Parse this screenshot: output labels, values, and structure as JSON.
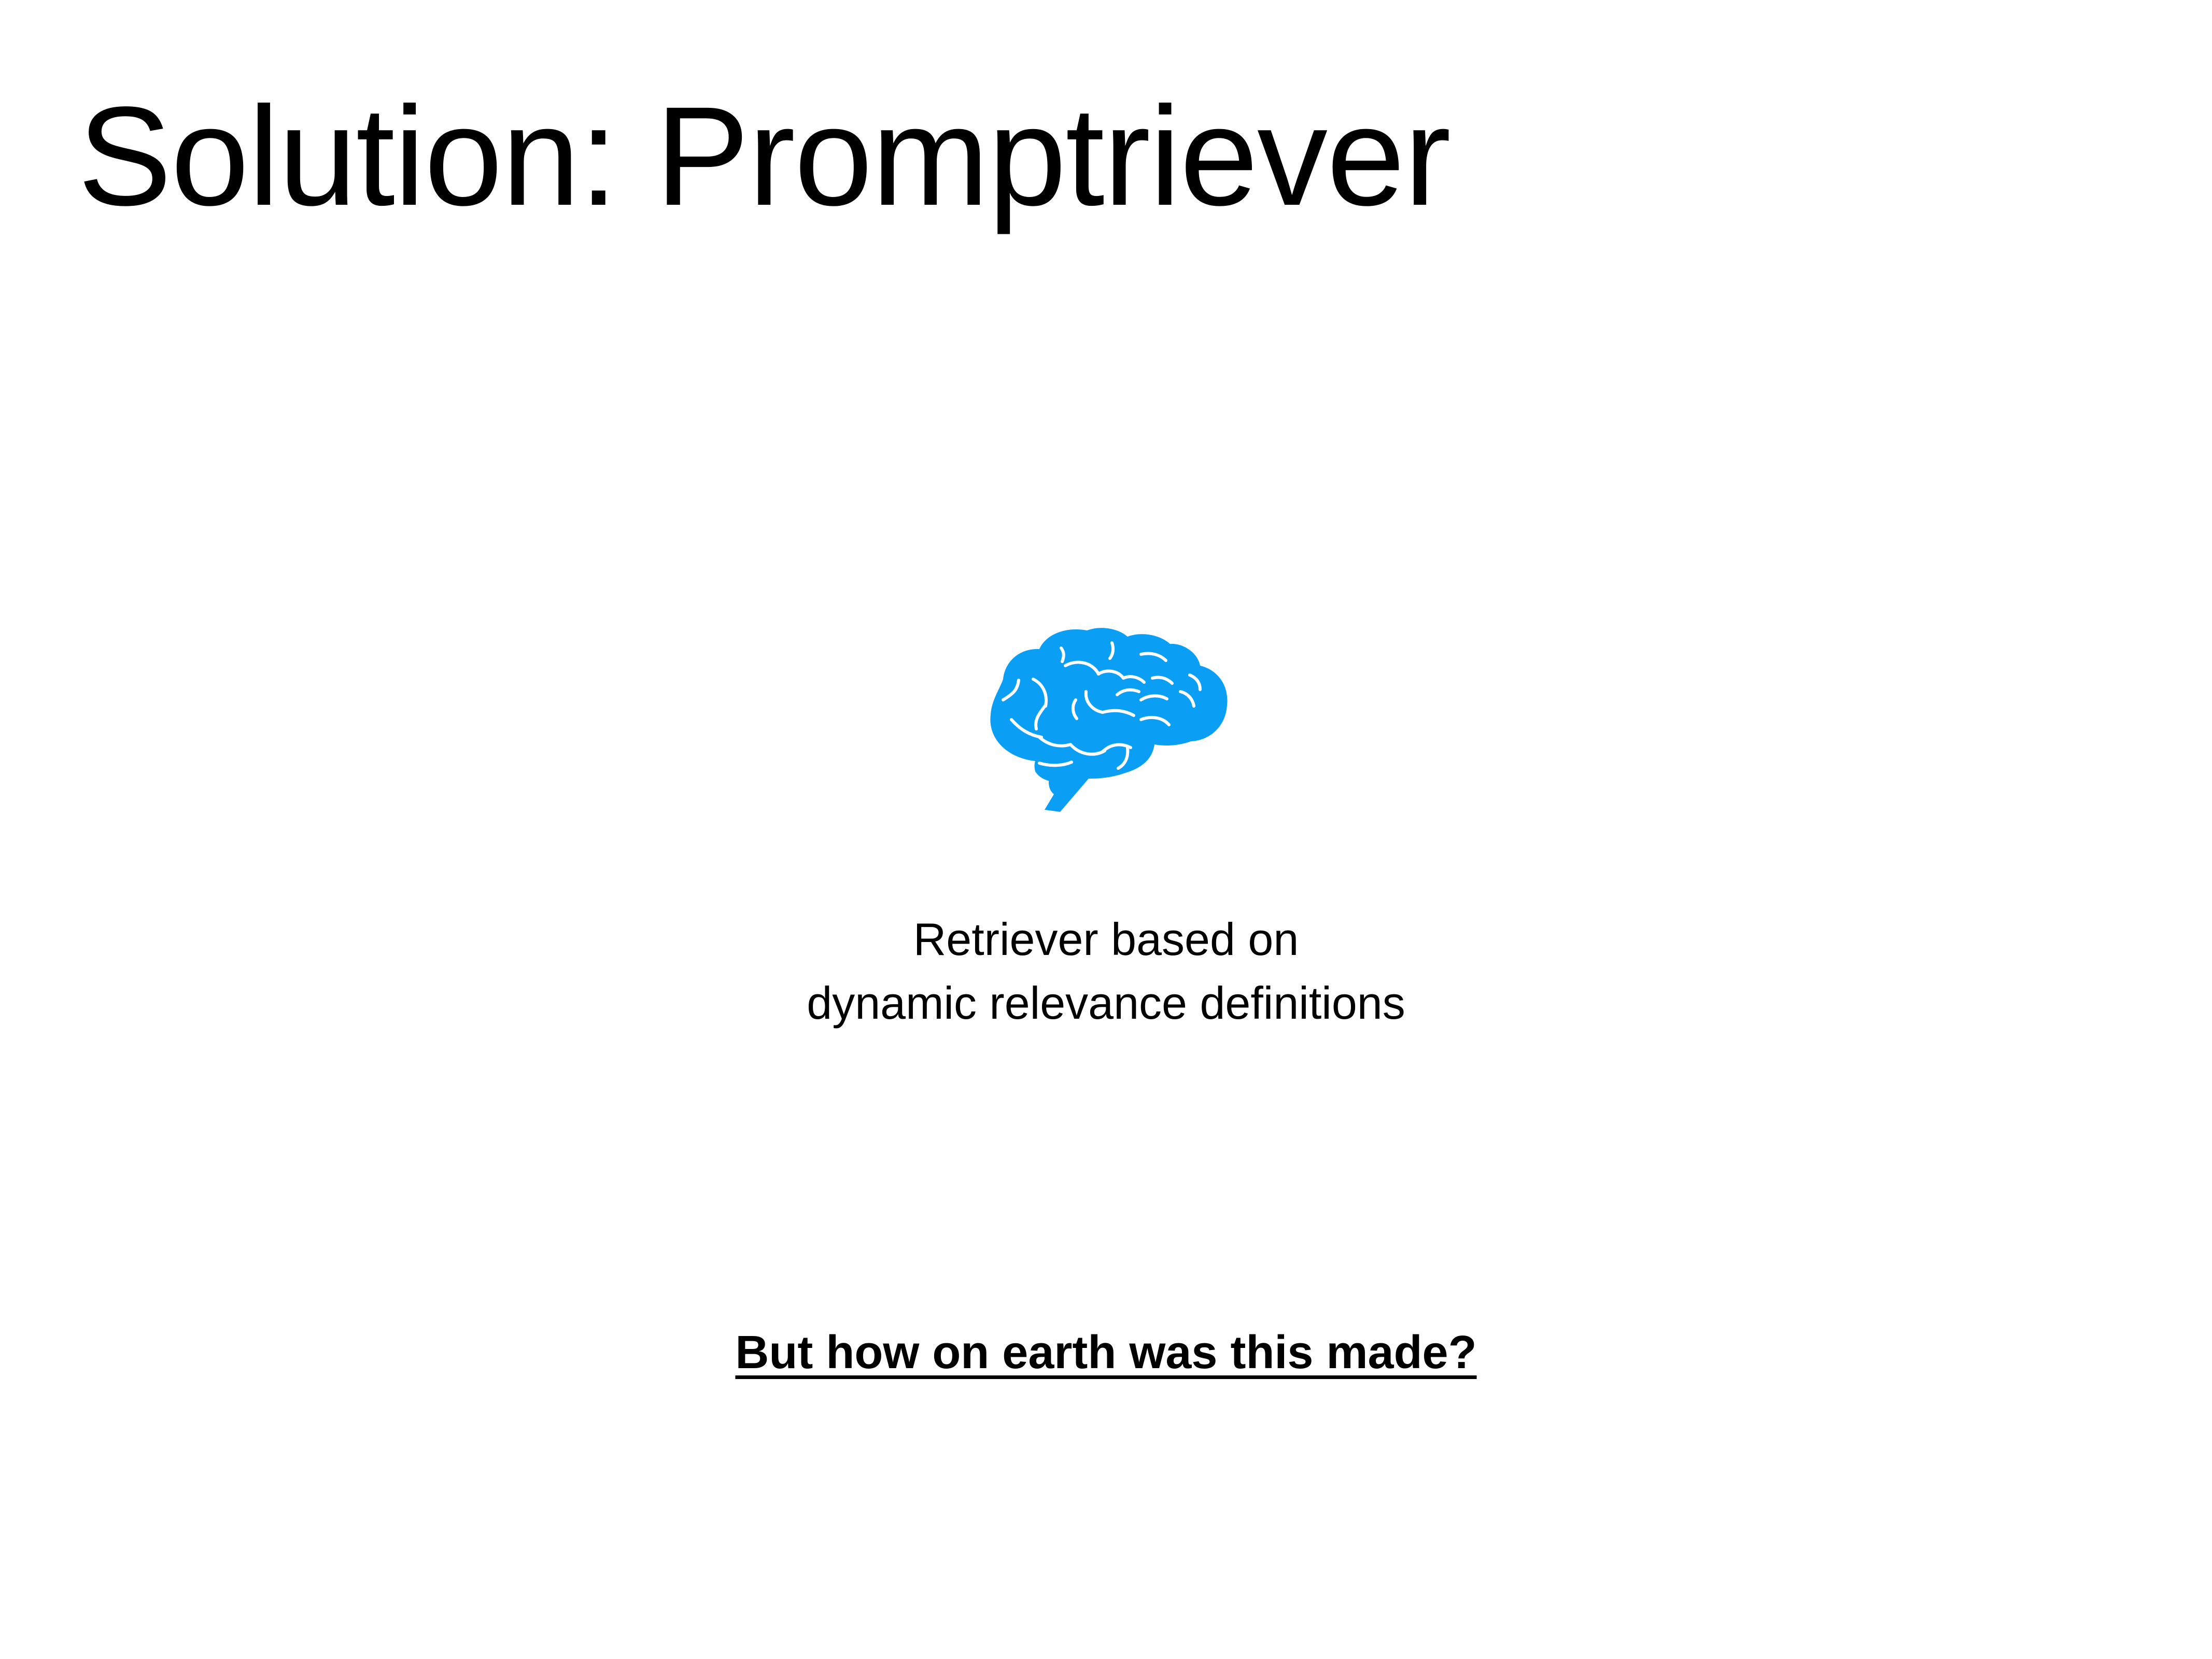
{
  "slide": {
    "title": "Solution: Promptriever",
    "icon": "brain-icon",
    "icon_color": "#0a9ef5",
    "caption_lines": [
      "Retriever based on",
      "dynamic relevance definitions"
    ],
    "question": "But how on earth was this made?"
  }
}
